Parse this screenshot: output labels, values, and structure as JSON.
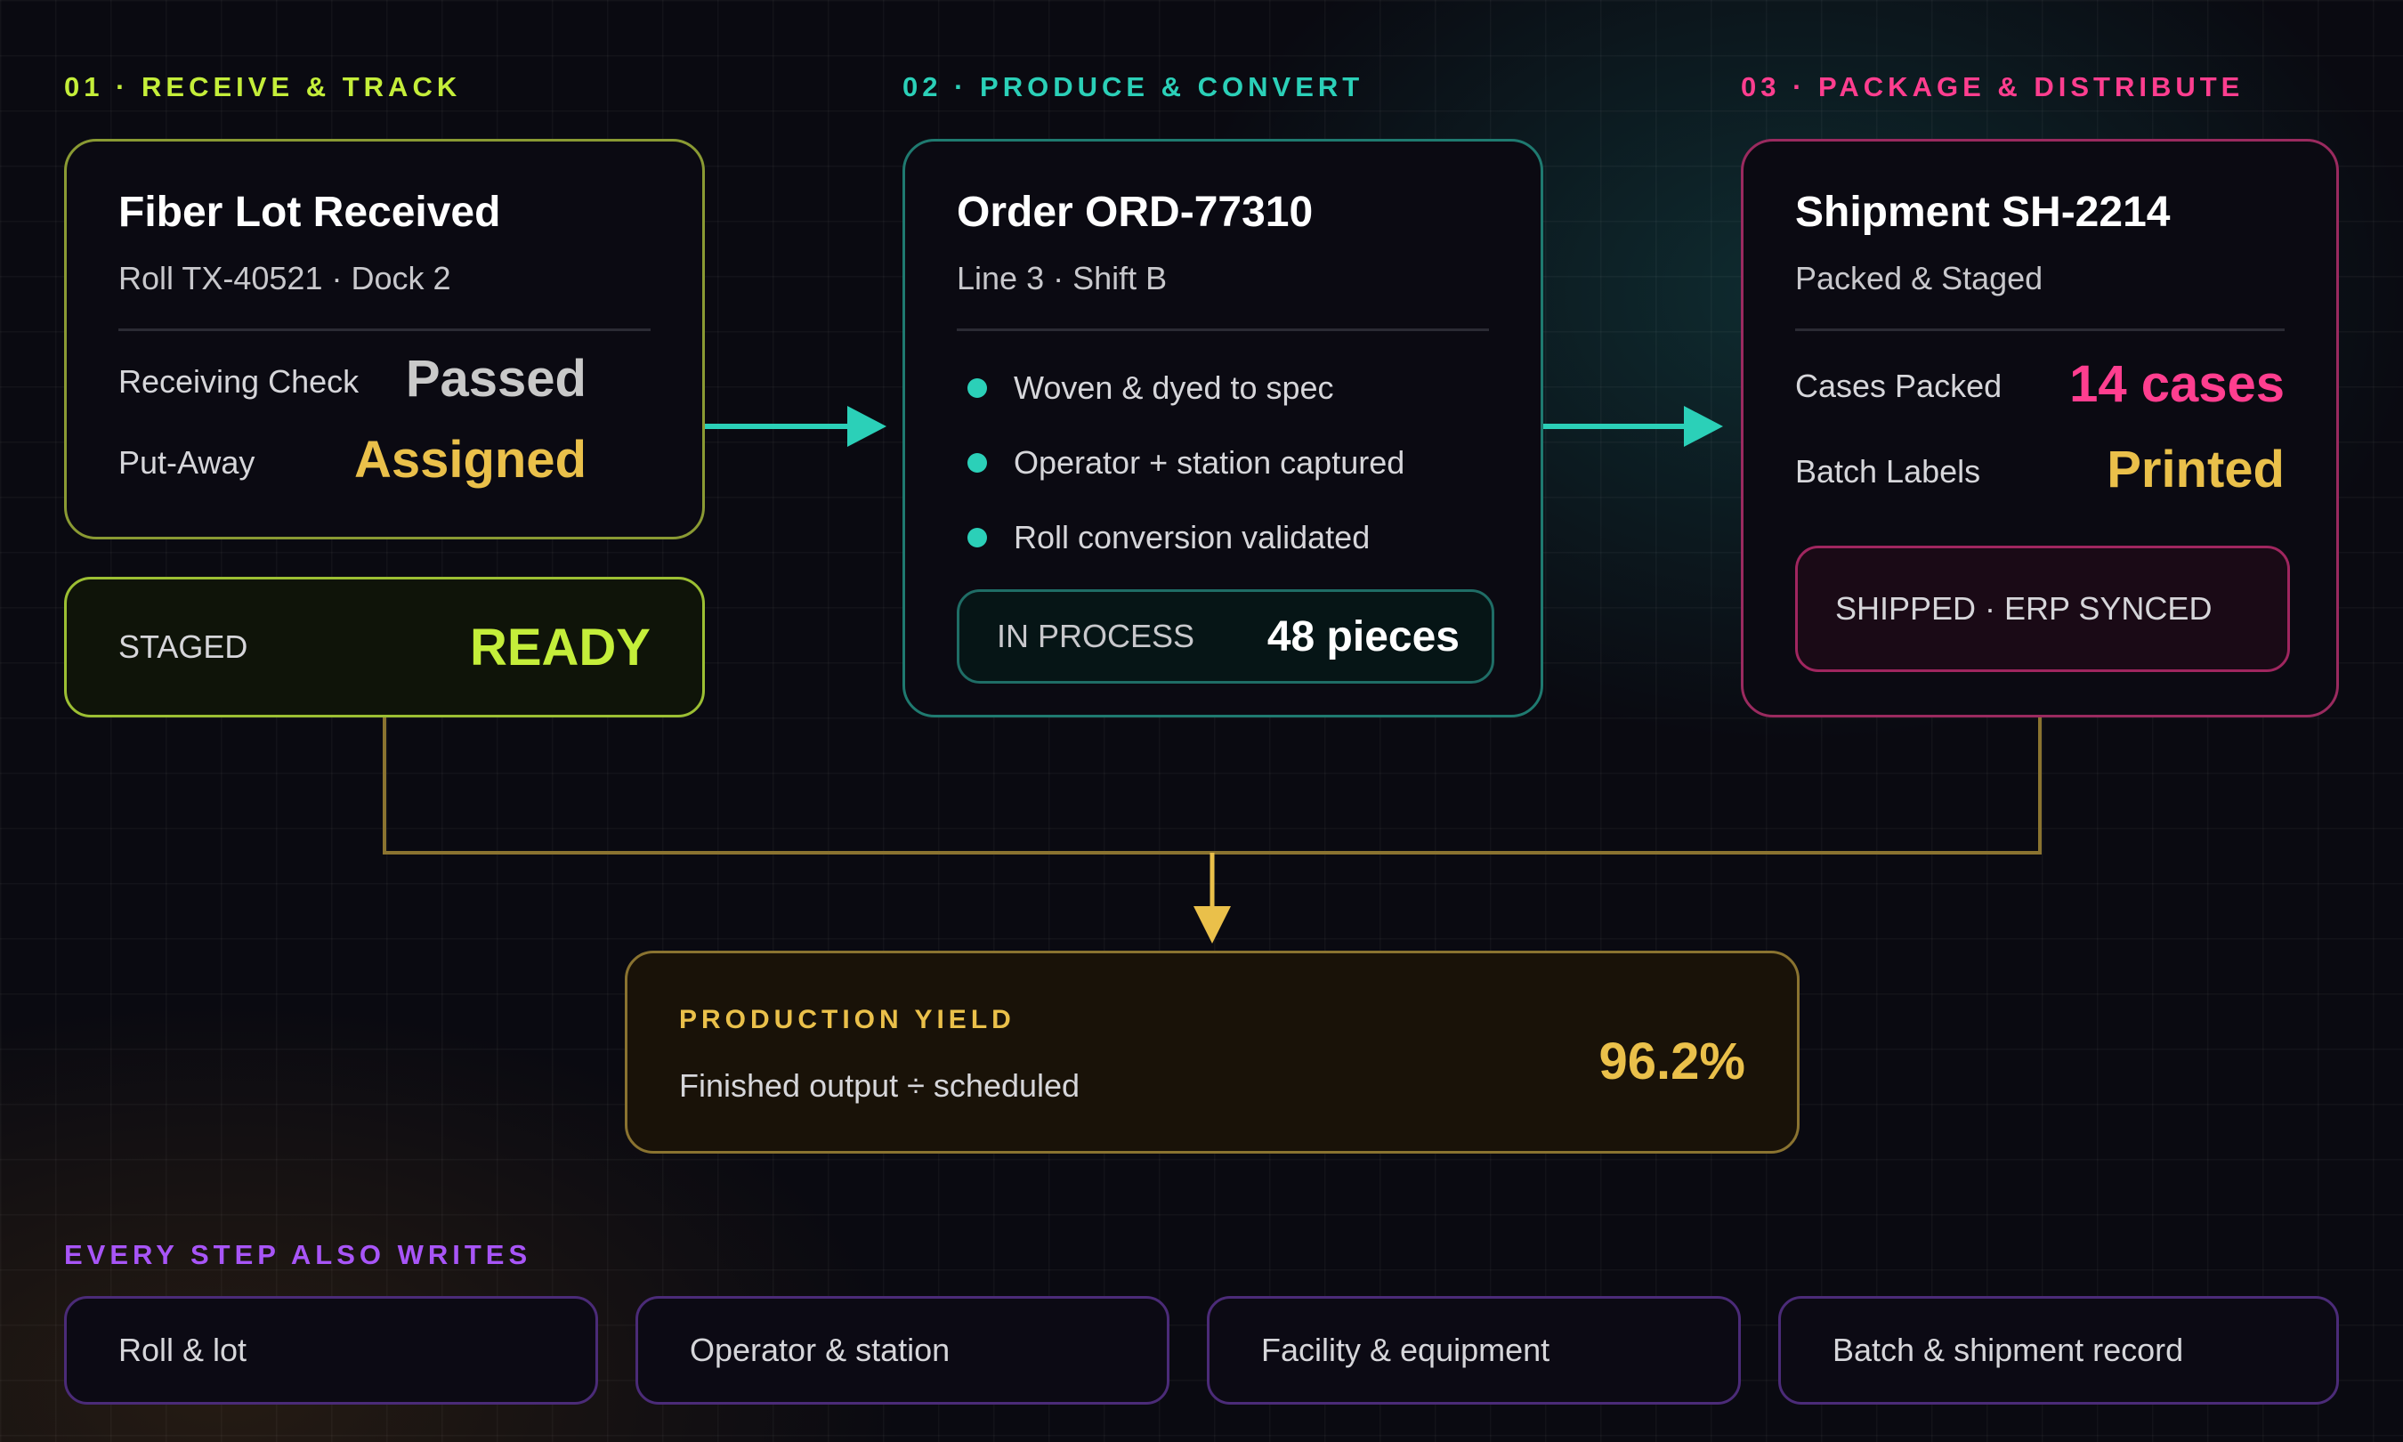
{
  "colors": {
    "lime": "#c4ee3a",
    "teal": "#2bd0b8",
    "pink": "#ff3e8f",
    "gold": "#eac04a",
    "purple": "#a855f7",
    "gray_value": "#c9c9c9"
  },
  "stages": [
    {
      "label": "01 · RECEIVE & TRACK",
      "card": {
        "title": "Fiber Lot Received",
        "subtitle": "Roll TX-40521 · Dock 2",
        "rows": [
          {
            "label": "Receiving Check",
            "value": "Passed"
          },
          {
            "label": "Put-Away",
            "value": "Assigned"
          }
        ]
      },
      "status": {
        "label": "STAGED",
        "value": "READY"
      }
    },
    {
      "label": "02 · PRODUCE & CONVERT",
      "card": {
        "title": "Order ORD-77310",
        "subtitle": "Line 3 · Shift B",
        "bullets": [
          "Woven & dyed to spec",
          "Operator + station captured",
          "Roll conversion validated"
        ]
      },
      "status": {
        "label": "IN PROCESS",
        "value": "48 pieces"
      }
    },
    {
      "label": "03 · PACKAGE & DISTRIBUTE",
      "card": {
        "title": "Shipment SH-2214",
        "subtitle": "Packed & Staged",
        "rows": [
          {
            "label": "Cases Packed",
            "value": "14 cases"
          },
          {
            "label": "Batch Labels",
            "value": "Printed"
          }
        ]
      },
      "status": {
        "label": "SHIPPED · ERP SYNCED"
      }
    }
  ],
  "yield": {
    "label": "PRODUCTION YIELD",
    "formula": "Finished output ÷ scheduled",
    "value": "96.2%"
  },
  "writes": {
    "label": "EVERY STEP ALSO WRITES",
    "items": [
      "Roll & lot",
      "Operator & station",
      "Facility & equipment",
      "Batch & shipment record"
    ]
  },
  "icons": {
    "flow_arrow": "arrow-right-icon",
    "merge_arrow": "arrow-down-icon",
    "bullet": "dot-icon"
  }
}
